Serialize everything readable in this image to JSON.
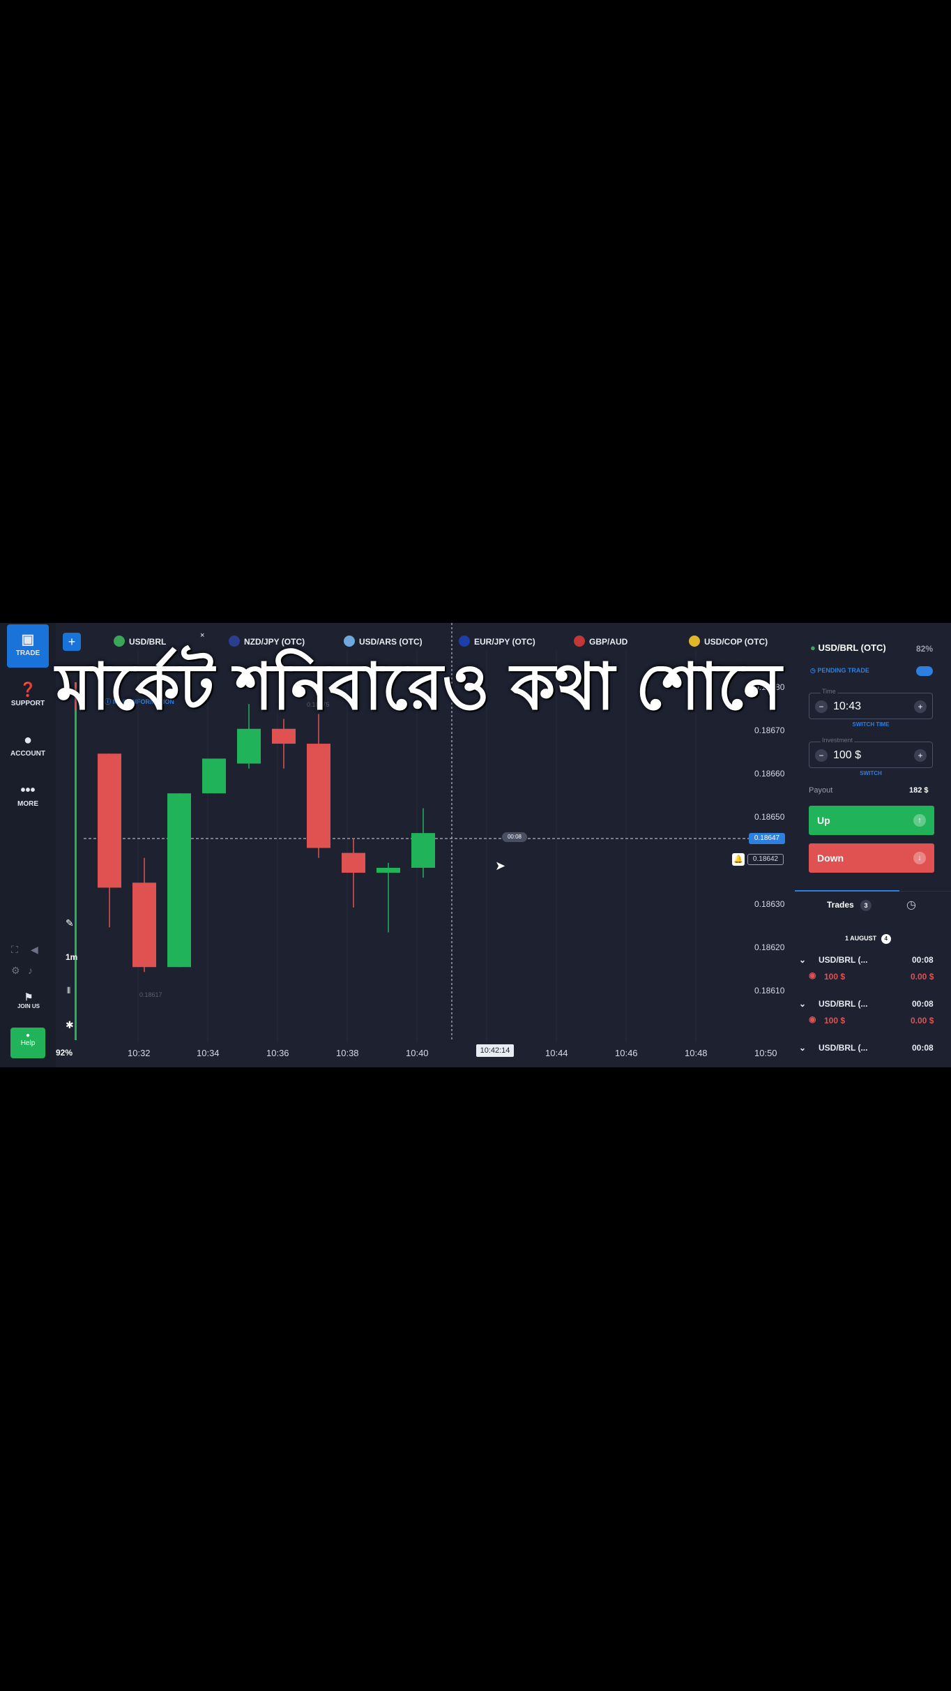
{
  "caption": "মার্কেট শনিবারেও কথা শোনে",
  "sidebar": {
    "items": [
      {
        "label": "TRADE",
        "icon": "chart-icon"
      },
      {
        "label": "SUPPORT",
        "icon": "question-icon"
      },
      {
        "label": "ACCOUNT",
        "icon": "user-icon"
      },
      {
        "label": "MORE",
        "icon": "more-icon"
      }
    ],
    "join_label": "JOIN US",
    "help_label": "Help",
    "zoom_label": "92%"
  },
  "tabs": [
    "USD/BRL",
    "NZD/JPY (OTC)",
    "USD/ARS (OTC)",
    "EUR/JPY (OTC)",
    "GBP/AUD",
    "USD/COP (OTC)"
  ],
  "chart": {
    "info_label": "MAIN INFORMATION",
    "timeframe": "1m",
    "current_price": "0.18647",
    "marker_price": "0.18642",
    "timer": "00:08",
    "cursor_time": "10:42:14",
    "low_label": "0.18617",
    "high_label": "0.18675"
  },
  "chart_data": {
    "type": "candlestick",
    "x_ticks": [
      "10:32",
      "10:34",
      "10:36",
      "10:38",
      "10:40",
      "10:44",
      "10:46",
      "10:48",
      "10:50"
    ],
    "y_ticks": [
      "0.18680",
      "0.18670",
      "0.18660",
      "0.18650",
      "0.18630",
      "0.18620",
      "0.18610"
    ],
    "ylim": [
      0.18605,
      0.18683
    ],
    "candles": [
      {
        "open": 0.18663,
        "close": 0.18636,
        "high": 0.18663,
        "low": 0.18628,
        "dir": "down"
      },
      {
        "open": 0.18637,
        "close": 0.1862,
        "high": 0.18642,
        "low": 0.18619,
        "dir": "down"
      },
      {
        "open": 0.1862,
        "close": 0.18655,
        "high": 0.18655,
        "low": 0.1862,
        "dir": "up"
      },
      {
        "open": 0.18655,
        "close": 0.18662,
        "high": 0.18662,
        "low": 0.18655,
        "dir": "up"
      },
      {
        "open": 0.18661,
        "close": 0.18668,
        "high": 0.18673,
        "low": 0.1866,
        "dir": "up"
      },
      {
        "open": 0.18668,
        "close": 0.18665,
        "high": 0.1867,
        "low": 0.1866,
        "dir": "down"
      },
      {
        "open": 0.18665,
        "close": 0.18644,
        "high": 0.18671,
        "low": 0.18642,
        "dir": "down"
      },
      {
        "open": 0.18643,
        "close": 0.18639,
        "high": 0.18646,
        "low": 0.18632,
        "dir": "down"
      },
      {
        "open": 0.18639,
        "close": 0.1864,
        "high": 0.18641,
        "low": 0.18627,
        "dir": "up"
      },
      {
        "open": 0.1864,
        "close": 0.18647,
        "high": 0.18652,
        "low": 0.18638,
        "dir": "up"
      }
    ]
  },
  "panel": {
    "asset": "USD/BRL (OTC)",
    "payout_pct": "82%",
    "pending_label": "PENDING TRADE",
    "time_label": "Time",
    "time_value": "10:43",
    "switch_time": "SWITCH TIME",
    "investment_label": "Investment",
    "investment_value": "100 $",
    "switch_label": "SWITCH",
    "payout_label": "Payout",
    "payout_value": "182 $",
    "up_label": "Up",
    "down_label": "Down",
    "trades_label": "Trades",
    "trades_count": "3",
    "date_label": "1 AUGUST",
    "date_count": "4",
    "trades": [
      {
        "asset": "USD/BRL (...",
        "time": "00:08",
        "amount": "100 $",
        "result": "0.00 $"
      },
      {
        "asset": "USD/BRL (...",
        "time": "00:08",
        "amount": "100 $",
        "result": "0.00 $"
      },
      {
        "asset": "USD/BRL (...",
        "time": "00:08"
      }
    ]
  },
  "colors": {
    "up": "#21b35a",
    "down": "#e05252",
    "accent": "#1a73d9"
  }
}
